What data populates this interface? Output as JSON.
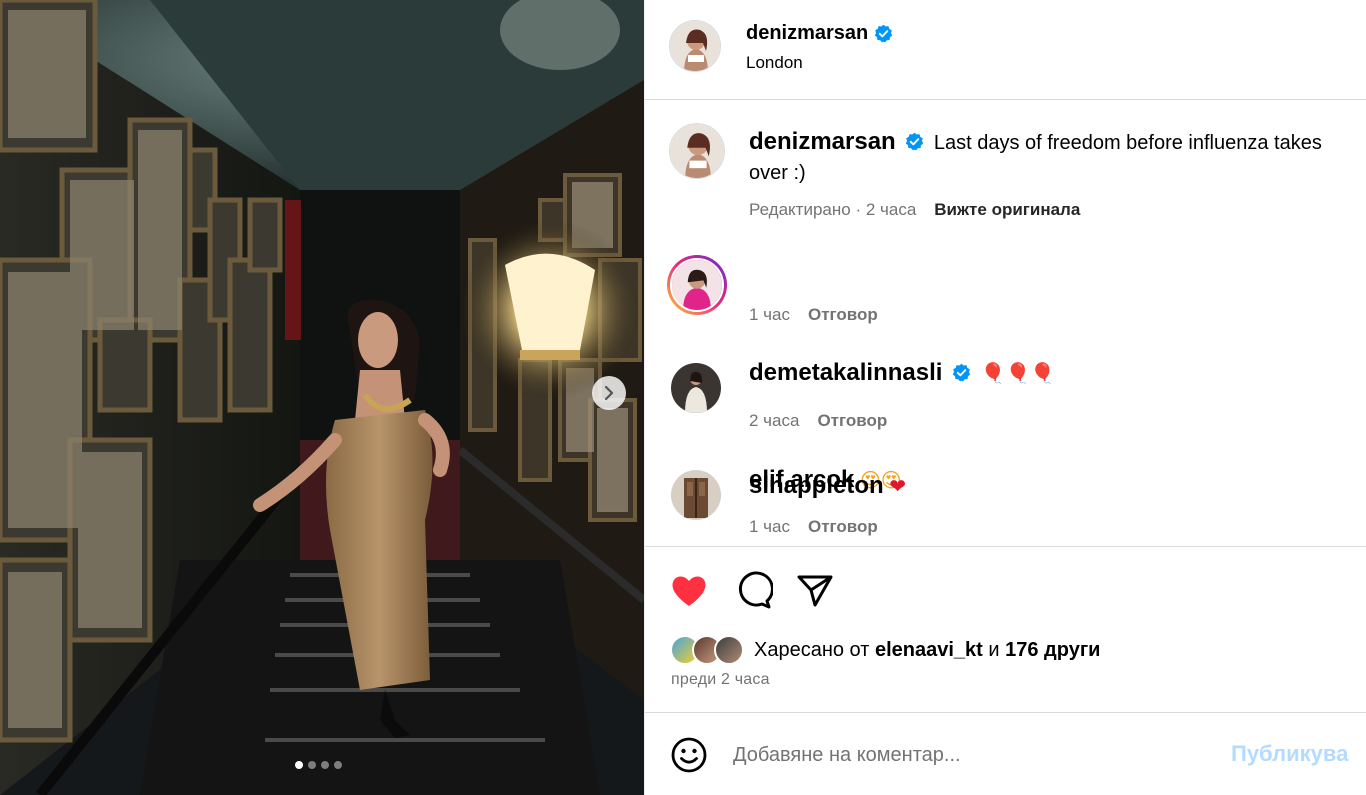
{
  "post": {
    "author": "denizmarsan",
    "location": "London",
    "caption": "Last days of freedom before influenza takes over :)",
    "edited_label": "Редактирано",
    "caption_time": "2 часа",
    "see_original": "Вижте оригинала",
    "carousel_total": 4,
    "carousel_index": 1
  },
  "comments": [
    {
      "user": "demetakalinnasli",
      "verified": true,
      "text": "🎈🎈🎈",
      "time": "1 час",
      "reply": "Отговор"
    },
    {
      "user": "elif.arcok",
      "verified": false,
      "text": "😍😍",
      "time": "2 часа",
      "reply": "Отговор"
    },
    {
      "user": "slnappleton",
      "verified": false,
      "text": "❤",
      "time": "1 час",
      "reply": "Отговор"
    }
  ],
  "likes": {
    "prefix": "Харесано от",
    "user": "elenaavi_kt",
    "joiner": "и",
    "others": "176 други"
  },
  "posted_ago": "преди 2 часа",
  "composer": {
    "placeholder": "Добавяне на коментар...",
    "post_label": "Публикува"
  },
  "icons": {
    "like": "heart-filled-icon",
    "comment": "speech-bubble-icon",
    "share": "paper-plane-icon",
    "emoji": "smiley-icon",
    "next": "chevron-right-icon",
    "verified": "verified-badge-icon"
  },
  "colors": {
    "like_red": "#ff3040",
    "verified_blue": "#0095f6",
    "muted_text": "#737373",
    "post_button_disabled": "#b3dbff"
  }
}
